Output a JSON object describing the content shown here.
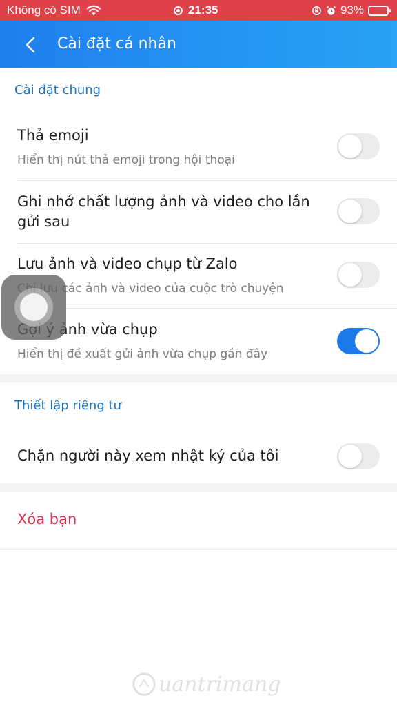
{
  "status_bar": {
    "carrier": "Không có SIM",
    "time": "21:35",
    "battery_percent": "93%",
    "battery_level": 0.93,
    "icons": [
      "wifi-icon",
      "screen-record-icon",
      "rotation-lock-icon",
      "alarm-icon",
      "battery-icon"
    ]
  },
  "header": {
    "title": "Cài đặt cá nhân",
    "back_icon": "chevron-left-icon"
  },
  "sections": {
    "general": {
      "title": "Cài đặt chung",
      "items": [
        {
          "title": "Thả emoji",
          "subtitle": "Hiển thị nút thả emoji trong hội thoại",
          "enabled": false
        },
        {
          "title": "Ghi nhớ chất lượng ảnh và video cho lần gửi sau",
          "subtitle": "",
          "enabled": false
        },
        {
          "title": "Lưu ảnh và video chụp từ Zalo",
          "subtitle": "Chỉ lưu các ảnh và video của cuộc trò chuyện",
          "enabled": false
        },
        {
          "title": "Gợi ý ảnh vừa chụp",
          "subtitle": "Hiển thị đề xuất gửi ảnh vừa chụp gần đây",
          "enabled": true
        }
      ]
    },
    "privacy": {
      "title": "Thiết lập riêng tư",
      "items": [
        {
          "title": "Chặn người này xem nhật ký của tôi",
          "enabled": false
        }
      ]
    }
  },
  "actions": {
    "remove_friend": "Xóa bạn"
  },
  "colors": {
    "status_bar": "#e0404a",
    "header_start": "#1f7ff0",
    "header_end": "#2aa3f2",
    "section_title": "#1a74c2",
    "toggle_on": "#1c7ae8",
    "danger": "#d7334d"
  },
  "watermark": {
    "text": "uantrimang",
    "icon": "watermark-logo-icon"
  }
}
